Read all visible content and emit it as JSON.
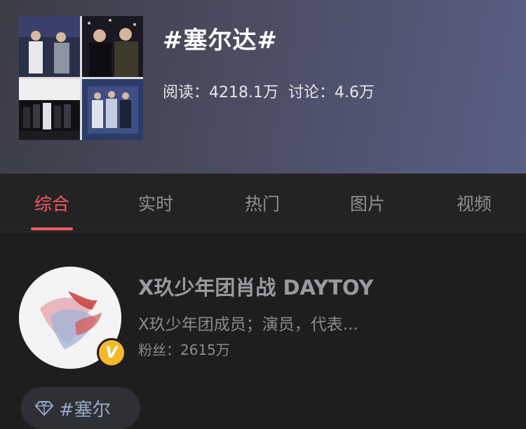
{
  "topic": {
    "title": "#塞尔达#",
    "reads_label": "阅读：",
    "reads_value": "4218.1万",
    "discuss_label": "讨论：",
    "discuss_value": "4.6万"
  },
  "tabs": [
    {
      "label": "综合",
      "active": true
    },
    {
      "label": "实时",
      "active": false
    },
    {
      "label": "热门",
      "active": false
    },
    {
      "label": "图片",
      "active": false
    },
    {
      "label": "视频",
      "active": false
    }
  ],
  "user": {
    "name": "X玖少年团肖战 DAYTOY",
    "bio": "X玖少年团成员；演员，代表...",
    "fans_label": "粉丝：",
    "fans_value": "2615万",
    "verified_mark": "V"
  },
  "chip": {
    "label": "#塞尔",
    "icon": "diamond-icon"
  },
  "colors": {
    "accent": "#f35b62",
    "verified": "#f4b82a",
    "background": "#1e1e1f"
  }
}
